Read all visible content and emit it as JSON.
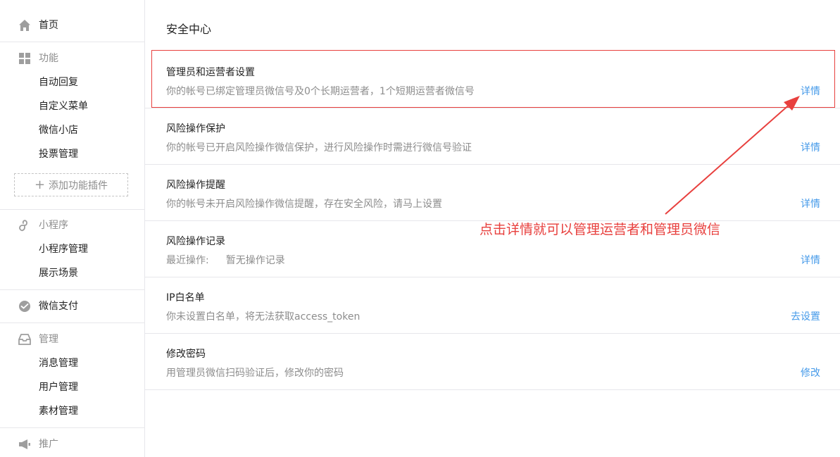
{
  "sidebar": {
    "home": "首页",
    "features": {
      "label": "功能",
      "items": [
        "自动回复",
        "自定义菜单",
        "微信小店",
        "投票管理"
      ],
      "add_plugin": "添加功能插件"
    },
    "mini_program": {
      "label": "小程序",
      "items": [
        "小程序管理",
        "展示场景"
      ]
    },
    "wechat_pay": "微信支付",
    "manage": {
      "label": "管理",
      "items": [
        "消息管理",
        "用户管理",
        "素材管理"
      ]
    },
    "promote": "推广"
  },
  "main": {
    "title": "安全中心",
    "rows": [
      {
        "title": "管理员和运营者设置",
        "desc": "你的帐号已绑定管理员微信号及0个长期运营者，1个短期运营者微信号",
        "link": "详情"
      },
      {
        "title": "风险操作保护",
        "desc": "你的帐号已开启风险操作微信保护，进行风险操作时需进行微信号验证",
        "link": "详情"
      },
      {
        "title": "风险操作提醒",
        "desc": "你的帐号未开启风险操作微信提醒，存在安全风险，请马上设置",
        "link": "详情"
      },
      {
        "title": "风险操作记录",
        "desc_label": "最近操作:",
        "desc_value": "暂无操作记录",
        "link": "详情"
      },
      {
        "title": "IP白名单",
        "desc": "你未设置白名单，将无法获取access_token",
        "link": "去设置"
      },
      {
        "title": "修改密码",
        "desc": "用管理员微信扫码验证后，修改你的密码",
        "link": "修改"
      }
    ]
  },
  "annotation": {
    "text": "点击详情就可以管理运营者和管理员微信",
    "color": "#e8403e"
  },
  "colors": {
    "link": "#459ae9",
    "muted": "#8d8d8d",
    "divider": "#e7e7eb"
  }
}
